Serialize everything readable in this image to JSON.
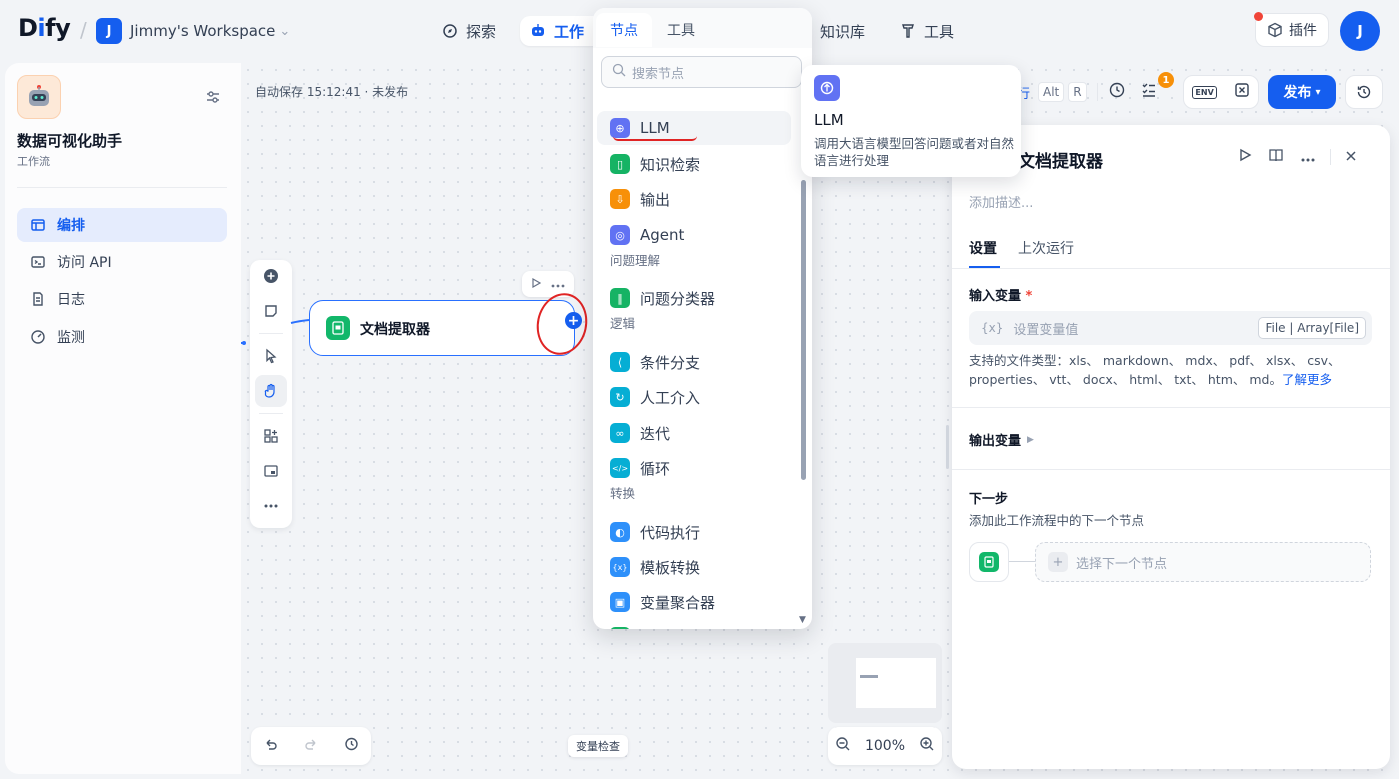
{
  "brand": {
    "logo_left": "D",
    "logo_i": "i",
    "logo_right": "fy"
  },
  "workspace": {
    "initial": "J",
    "name": "Jimmy's Workspace",
    "chevron": "⌄"
  },
  "nav": {
    "explore": "探索",
    "studio": "工作",
    "knowledge": "知识库",
    "tools": "工具"
  },
  "header_right": {
    "plugins": "插件",
    "avatar_initial": "J"
  },
  "app": {
    "title": "数据可视化助手",
    "subtitle": "工作流"
  },
  "sidebar_items": [
    {
      "label": "编排",
      "icon": "layout-icon"
    },
    {
      "label": "访问 API",
      "icon": "terminal-icon"
    },
    {
      "label": "日志",
      "icon": "document-icon"
    },
    {
      "label": "监测",
      "icon": "gauge-icon"
    }
  ],
  "canvas": {
    "autosave": "自动保存 15:12:41 · 未发布",
    "node_title": "文档提取器",
    "var_inspect": "变量检查",
    "zoom": "100%"
  },
  "run_controls": {
    "run": "运行",
    "key1": "Alt",
    "key2": "R",
    "checklist_count": "1",
    "env": "ENV",
    "publish": "发布"
  },
  "panel": {
    "title": "文档提取器",
    "description_placeholder": "添加描述...",
    "tabs": [
      "设置",
      "上次运行"
    ],
    "input_vars_label": "输入变量",
    "required_mark": "*",
    "input_placeholder": "设置变量值",
    "input_type": "File | Array[File]",
    "supported_types": "支持的文件类型：xls、 markdown、 mdx、 pdf、 xlsx、 csv、 properties、 vtt、 docx、 html、 txt、 htm、 md。",
    "learn_more": "了解更多",
    "output_vars_label": "输出变量",
    "next_step_label": "下一步",
    "next_step_sub": "添加此工作流程中的下一个节点",
    "select_next": "选择下一个节点"
  },
  "picker": {
    "tabs": [
      "节点",
      "工具"
    ],
    "search_placeholder": "搜索节点",
    "items_top": [
      {
        "label": "LLM",
        "color": "#6172f3"
      },
      {
        "label": "知识检索",
        "color": "#16b364"
      },
      {
        "label": "输出",
        "color": "#f79009"
      },
      {
        "label": "Agent",
        "color": "#6172f3"
      }
    ],
    "group_question": "问题理解",
    "items_question": [
      {
        "label": "问题分类器",
        "color": "#16b364"
      }
    ],
    "group_logic": "逻辑",
    "items_logic": [
      {
        "label": "条件分支",
        "color": "#06aed4"
      },
      {
        "label": "人工介入",
        "color": "#06aed4"
      },
      {
        "label": "迭代",
        "color": "#06aed4"
      },
      {
        "label": "循环",
        "color": "#06aed4"
      }
    ],
    "group_transform": "转换",
    "items_transform": [
      {
        "label": "代码执行",
        "color": "#2e90fa"
      },
      {
        "label": "模板转换",
        "color": "#2e90fa"
      },
      {
        "label": "变量聚合器",
        "color": "#2e90fa"
      },
      {
        "label": "文档提取器",
        "color": "#16b364"
      }
    ]
  },
  "tooltip": {
    "title": "LLM",
    "description": "调用大语言模型回答问题或者对自然语言进行处理"
  }
}
